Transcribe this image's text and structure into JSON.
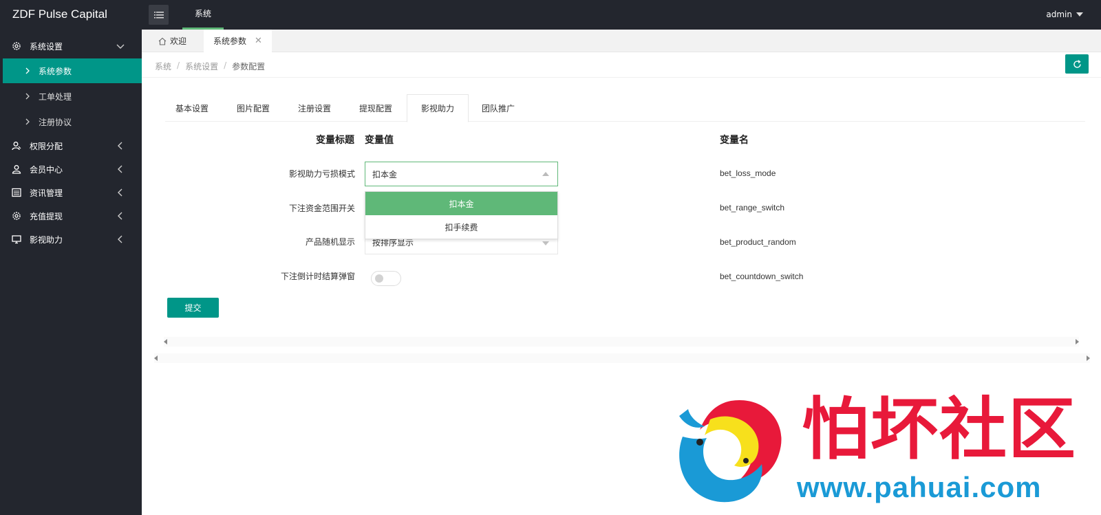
{
  "app": {
    "brand": "ZDF Pulse Capital",
    "user": "admin"
  },
  "top_nav": {
    "label": "系统"
  },
  "sidebar": {
    "groups": [
      {
        "label": "系统设置",
        "icon": "gear-icon"
      },
      {
        "label": "权限分配",
        "icon": "users-icon"
      },
      {
        "label": "会员中心",
        "icon": "user-icon"
      },
      {
        "label": "资讯管理",
        "icon": "news-icon"
      },
      {
        "label": "充值提现",
        "icon": "gear-icon"
      },
      {
        "label": "影视助力",
        "icon": "monitor-icon"
      }
    ],
    "sub_items": [
      {
        "label": "系统参数",
        "active": true
      },
      {
        "label": "工单处理",
        "active": false
      },
      {
        "label": "注册协议",
        "active": false
      }
    ]
  },
  "page_tabs": [
    {
      "label": "欢迎",
      "icon": "home-icon"
    },
    {
      "label": "系统参数",
      "close": "✕"
    }
  ],
  "breadcrumb": {
    "items": [
      "系统",
      "系统设置",
      "参数配置"
    ],
    "separator": "/"
  },
  "config_tabs": [
    "基本设置",
    "图片配置",
    "注册设置",
    "提现配置",
    "影视助力",
    "团队推广"
  ],
  "active_config_tab": "影视助力",
  "form": {
    "headers": {
      "title": "变量标题",
      "value": "变量值",
      "name": "变量名"
    },
    "rows": [
      {
        "label": "影视助力亏损模式",
        "value": "扣本金",
        "var": "bet_loss_mode"
      },
      {
        "label": "下注资金范围开关",
        "value": "",
        "var": "bet_range_switch"
      },
      {
        "label": "产品随机显示",
        "value": "按排序显示",
        "var": "bet_product_random"
      },
      {
        "label": "下注倒计时结算弹窗",
        "value": "off",
        "var": "bet_countdown_switch"
      }
    ],
    "dropdown_options": [
      "扣本金",
      "扣手续费"
    ],
    "selected_option": "扣本金",
    "submit_label": "提交"
  },
  "watermark": {
    "title": "怕坏社区",
    "url": "www.pahuai.com"
  },
  "colors": {
    "accent": "#009688",
    "selected": "#5fb878",
    "dark": "#23262e",
    "watermark_red": "#e8193a",
    "watermark_blue": "#1a9ad6"
  }
}
